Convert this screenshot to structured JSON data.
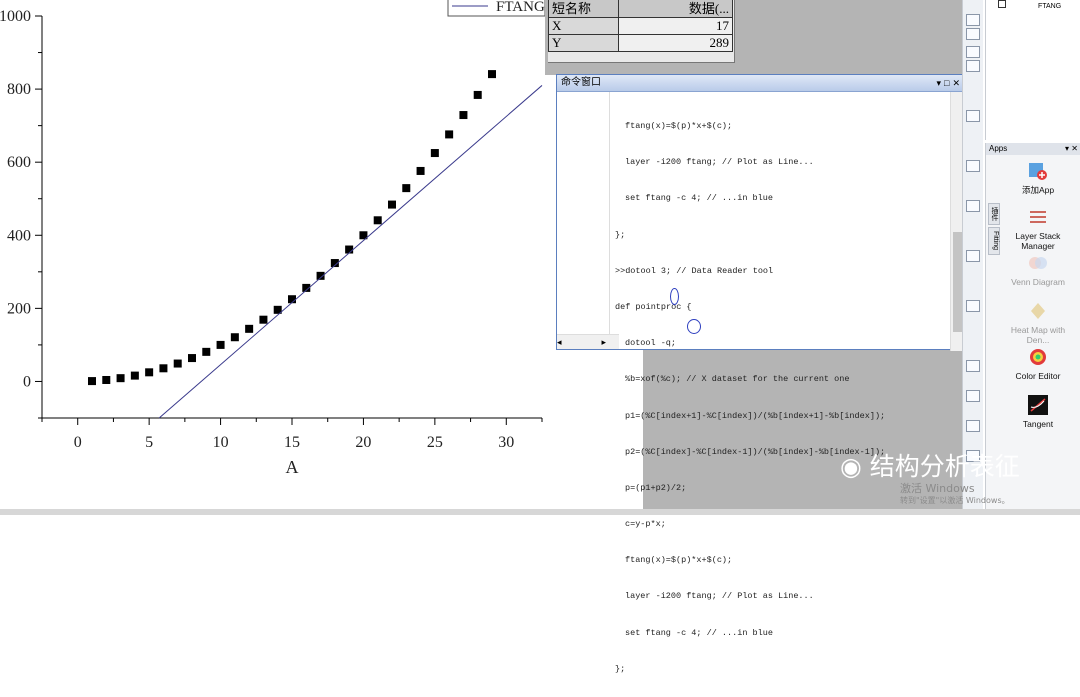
{
  "chart_data": {
    "type": "scatter",
    "xlabel": "A",
    "xlim": [
      -2.5,
      32.5
    ],
    "ylim": [
      -100,
      1000
    ],
    "x_ticks": [
      "0",
      "5",
      "10",
      "15",
      "20",
      "25",
      "30"
    ],
    "y_ticks": [
      "0",
      "200",
      "400",
      "600",
      "800",
      "1000"
    ],
    "series": [
      {
        "name": "",
        "kind": "points",
        "color": "#000000",
        "x": [
          1,
          2,
          3,
          4,
          5,
          6,
          7,
          8,
          9,
          10,
          11,
          12,
          13,
          14,
          15,
          16,
          17,
          18,
          19,
          20,
          21,
          22,
          23,
          24,
          25,
          26,
          27,
          28,
          29
        ],
        "y": [
          1,
          4,
          9,
          16,
          25,
          36,
          49,
          64,
          81,
          100,
          121,
          144,
          169,
          196,
          225,
          256,
          289,
          324,
          361,
          400,
          441,
          484,
          529,
          576,
          625,
          676,
          729,
          784,
          841
        ]
      },
      {
        "name": "FTANG",
        "kind": "line",
        "color": "#3a3a8c",
        "x": [
          5.7,
          32.5
        ],
        "y": [
          -100,
          810
        ]
      }
    ],
    "legend": "top-right"
  },
  "data_table": {
    "headers": [
      "短名称",
      "数据(..."
    ],
    "rows": [
      [
        "X",
        "17"
      ],
      [
        "Y",
        "289"
      ]
    ]
  },
  "command_window": {
    "title": "命令窗口",
    "lines": [
      "ftang(x)=$(p)*x+$(c);",
      "layer -i200 ftang; // Plot as Line...",
      "set ftang -c 4; // ...in blue",
      "};",
      ">>dotool 3; // Data Reader tool",
      "def pointproc {",
      "dotool -q;",
      "%b=xof(%c); // X dataset for the current one",
      "p1=(%C[index+1]-%C[index])/(%b[index+1]-%b[index]);",
      "p2=(%C[index]-%C[index-1])/(%b[index]-%b[index-1]);",
      "p=(p1+p2)/2;",
      "c=y-p*x;",
      "ftang(x)=$(p)*x+$(c);",
      "layer -i200 ftang; // Plot as Line...",
      "set ftang -c 4; // ...in blue",
      "};"
    ]
  },
  "layer_panel": {
    "item": "FTANG"
  },
  "apps": {
    "header": "Apps",
    "tabs": [
      "插件",
      "Fitting"
    ],
    "items": [
      {
        "label": "添加App",
        "icon": "add-app-icon"
      },
      {
        "label": "Layer Stack Manager",
        "icon": "layer-stack-icon"
      },
      {
        "label": "Venn Diagram",
        "icon": "venn-diagram-icon"
      },
      {
        "label": "Heat Map with Den...",
        "icon": "heat-map-icon"
      },
      {
        "label": "Color Editor",
        "icon": "color-editor-icon"
      },
      {
        "label": "Tangent",
        "icon": "tangent-icon"
      }
    ]
  },
  "watermark": "结构分析表征",
  "activate": {
    "line1": "激活 Windows",
    "line2": "转到\"设置\"以激活 Windows。"
  },
  "colors": {
    "accent": "#5b7fbf",
    "highlight_circle": "#2e3fbf"
  }
}
